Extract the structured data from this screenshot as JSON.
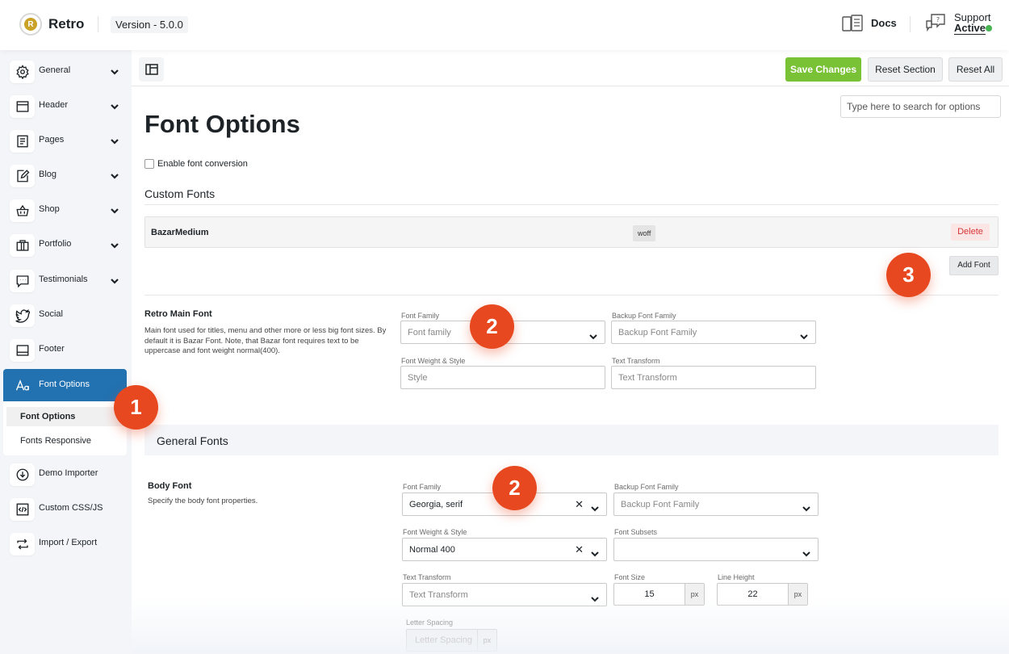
{
  "header": {
    "brand": "Retro",
    "logo_letter": "R",
    "version": "Version - 5.0.0",
    "docs_label": "Docs",
    "support_label": "Support",
    "support_status": "Active",
    "support_status_color": "#46b450"
  },
  "sidebar": {
    "items": [
      {
        "label": "General",
        "icon": "gear-icon"
      },
      {
        "label": "Header",
        "icon": "window-icon"
      },
      {
        "label": "Pages",
        "icon": "document-icon"
      },
      {
        "label": "Blog",
        "icon": "edit-icon"
      },
      {
        "label": "Shop",
        "icon": "basket-icon"
      },
      {
        "label": "Portfolio",
        "icon": "portfolio-icon"
      },
      {
        "label": "Testimonials",
        "icon": "chat-icon"
      },
      {
        "label": "Social",
        "icon": "twitter-icon"
      },
      {
        "label": "Footer",
        "icon": "footer-icon"
      },
      {
        "label": "Font Options",
        "icon": "font-icon"
      },
      {
        "label": "Demo Importer",
        "icon": "download-icon"
      },
      {
        "label": "Custom CSS/JS",
        "icon": "code-icon"
      },
      {
        "label": "Import / Export",
        "icon": "swap-icon"
      }
    ],
    "active_label": "Font Options",
    "submenu": [
      "Font Options",
      "Fonts Responsive"
    ]
  },
  "toolbar": {
    "save_label": "Save Changes",
    "reset_section_label": "Reset Section",
    "reset_all_label": "Reset All",
    "search_placeholder": "Type here to search for options",
    "save_color": "#79c135"
  },
  "main": {
    "title": "Font Options",
    "enable_conversion_label": "Enable font conversion",
    "custom_fonts_heading": "Custom Fonts",
    "custom_font": {
      "name": "BazarMedium",
      "type": "woff",
      "delete_label": "Delete"
    },
    "add_font_label": "Add Font",
    "main_font": {
      "title": "Retro Main Font",
      "desc": "Main font used for titles, menu and other more or less big font sizes. By default it is Bazar Font. Note, that Bazar font requires text to be uppercase and font weight normal(400).",
      "font_family_label": "Font Family",
      "font_family_placeholder": "Font family",
      "backup_label": "Backup Font Family",
      "backup_placeholder": "Backup Font Family",
      "weight_label": "Font Weight & Style",
      "weight_placeholder": "Style",
      "transform_label": "Text Transform",
      "transform_placeholder": "Text Transform"
    },
    "general_fonts_heading": "General Fonts",
    "body_font": {
      "title": "Body Font",
      "desc": "Specify the body font properties.",
      "font_family_label": "Font Family",
      "font_family_value": "Georgia, serif",
      "backup_label": "Backup Font Family",
      "backup_placeholder": "Backup Font Family",
      "weight_label": "Font Weight & Style",
      "weight_value": "Normal 400",
      "subsets_label": "Font Subsets",
      "transform_label": "Text Transform",
      "transform_placeholder": "Text Transform",
      "size_label": "Font Size",
      "size_value": "15",
      "line_height_label": "Line Height",
      "line_height_value": "22",
      "unit": "px",
      "letter_spacing_label": "Letter Spacing",
      "letter_spacing_placeholder": "Letter Spacing"
    }
  },
  "callouts": [
    "1",
    "2",
    "2",
    "3"
  ],
  "accent_color": "#2271b1",
  "callout_color": "#e8481f"
}
